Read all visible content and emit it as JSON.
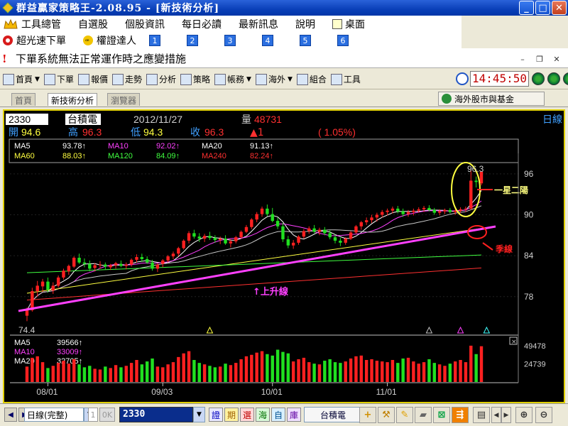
{
  "window": {
    "title": "群益贏家策略王-2.08.95 - [新技術分析]",
    "min": "_",
    "max": "□",
    "close": "✕"
  },
  "menu": {
    "items": [
      "工具總管",
      "自選股",
      "個股資訊",
      "每日必讀",
      "最新訊息",
      "說明"
    ],
    "desk": "桌面"
  },
  "quick": {
    "items": [
      "超光速下單",
      "權證達人"
    ],
    "numbers": [
      "1",
      "2",
      "3",
      "4",
      "5",
      "6"
    ]
  },
  "notice": {
    "text": "下單系統無法正常運作時之應變措施"
  },
  "mdi": {
    "min": "–",
    "restore": "❐",
    "close": "✕"
  },
  "toolbar": {
    "items": [
      "首頁",
      "下單",
      "報價",
      "走勢",
      "分析",
      "策略",
      "帳務",
      "海外",
      "組合",
      "工具"
    ],
    "clock": "14:45:50"
  },
  "tabs": {
    "items": [
      "首頁",
      "新技術分析",
      "瀏覽器"
    ],
    "oversea": "海外股市與基金"
  },
  "chart_data": {
    "type": "candlestick",
    "header": {
      "code": "2330",
      "name": "台積電",
      "date": "2012/11/27",
      "vol_label": "量",
      "vol": "48731",
      "open_label": "開",
      "open": "94.6",
      "high_label": "高",
      "high": "96.3",
      "low_label": "低",
      "low": "94.3",
      "close_label": "收",
      "close": "96.3",
      "change": "▲1",
      "pct": "( 1.05%)",
      "period": "日線"
    },
    "ma": [
      {
        "name": "MA5",
        "value": "93.78↑",
        "color": "#ffffff"
      },
      {
        "name": "MA10",
        "value": "92.02↑",
        "color": "#ff40ff"
      },
      {
        "name": "MA20",
        "value": "91.13↑",
        "color": "#ffffff"
      },
      {
        "name": "MA60",
        "value": "88.03↑",
        "color": "#ffff40"
      },
      {
        "name": "MA120",
        "value": "84.09↑",
        "color": "#40ff40"
      },
      {
        "name": "MA240",
        "value": "82.24↑",
        "color": "#ff3030"
      }
    ],
    "vol_ma": [
      {
        "name": "MA5",
        "value": "39566↑",
        "color": "#ffffff"
      },
      {
        "name": "MA10",
        "value": "33009↑",
        "color": "#ff40ff"
      },
      {
        "name": "MA20",
        "value": "32705↑",
        "color": "#ffffff"
      }
    ],
    "yticks": [
      "96",
      "90",
      "84",
      "78"
    ],
    "ylim": [
      73.5,
      99
    ],
    "vol_ticks": [
      "49478",
      "24739"
    ],
    "vol_max": 60000,
    "xticks": [
      {
        "i": 4,
        "label": "08/01"
      },
      {
        "i": 26,
        "label": "09/03"
      },
      {
        "i": 47,
        "label": "10/01"
      },
      {
        "i": 69,
        "label": "11/01"
      }
    ],
    "annot": {
      "peak": "96.3",
      "low": "74.4",
      "uptrend": "↑上升線",
      "season": "季線",
      "pattern": "一星二陽",
      "close_box": "×"
    },
    "candles": [
      [
        75.2,
        76.4,
        74.4,
        76.0
      ],
      [
        76.0,
        79.3,
        75.8,
        78.8
      ],
      [
        78.8,
        80.3,
        78.0,
        79.6
      ],
      [
        79.5,
        80.6,
        78.7,
        80.2
      ],
      [
        80.2,
        80.8,
        78.6,
        79.0
      ],
      [
        78.9,
        80.1,
        78.4,
        79.6
      ],
      [
        79.6,
        81.1,
        79.3,
        80.8
      ],
      [
        80.8,
        82.1,
        80.5,
        81.8
      ],
      [
        81.7,
        82.7,
        81.2,
        82.5
      ],
      [
        82.4,
        83.9,
        82.2,
        83.7
      ],
      [
        83.7,
        84.3,
        82.8,
        83.0
      ],
      [
        83.0,
        83.6,
        82.3,
        82.8
      ],
      [
        82.8,
        83.3,
        81.7,
        82.1
      ],
      [
        82.2,
        82.9,
        81.7,
        82.6
      ],
      [
        82.6,
        83.2,
        82.1,
        82.7
      ],
      [
        82.7,
        83.0,
        82.0,
        82.4
      ],
      [
        82.3,
        82.8,
        81.9,
        82.6
      ],
      [
        82.6,
        83.1,
        82.1,
        82.9
      ],
      [
        82.8,
        83.3,
        82.3,
        82.5
      ],
      [
        82.5,
        83.0,
        82.0,
        82.7
      ],
      [
        82.7,
        83.6,
        82.4,
        83.4
      ],
      [
        83.4,
        84.2,
        83.0,
        83.8
      ],
      [
        83.8,
        84.3,
        83.1,
        83.5
      ],
      [
        83.5,
        83.9,
        82.8,
        83.0
      ],
      [
        83.0,
        83.4,
        81.8,
        82.1
      ],
      [
        82.1,
        82.9,
        81.6,
        82.7
      ],
      [
        82.8,
        83.5,
        82.3,
        83.3
      ],
      [
        83.3,
        84.1,
        83.0,
        83.9
      ],
      [
        83.9,
        84.6,
        83.5,
        84.3
      ],
      [
        84.3,
        85.3,
        83.9,
        85.1
      ],
      [
        85.1,
        86.4,
        84.9,
        86.2
      ],
      [
        86.2,
        87.6,
        85.8,
        87.3
      ],
      [
        87.3,
        87.8,
        86.5,
        86.8
      ],
      [
        86.8,
        87.3,
        86.0,
        86.5
      ],
      [
        86.5,
        87.2,
        86.0,
        86.9
      ],
      [
        86.9,
        87.5,
        86.3,
        86.6
      ],
      [
        86.6,
        87.0,
        85.9,
        86.3
      ],
      [
        86.3,
        86.8,
        85.7,
        86.5
      ],
      [
        86.5,
        87.0,
        85.6,
        85.8
      ],
      [
        85.8,
        86.4,
        85.2,
        86.1
      ],
      [
        86.1,
        86.9,
        85.8,
        86.7
      ],
      [
        86.7,
        87.7,
        86.5,
        87.5
      ],
      [
        87.5,
        88.5,
        87.3,
        88.2
      ],
      [
        88.2,
        89.5,
        87.9,
        89.3
      ],
      [
        89.3,
        90.4,
        88.9,
        90.1
      ],
      [
        90.1,
        91.2,
        89.7,
        90.9
      ],
      [
        90.9,
        91.5,
        89.8,
        90.1
      ],
      [
        90.1,
        91.0,
        88.9,
        89.1
      ],
      [
        89.1,
        89.6,
        87.9,
        88.3
      ],
      [
        88.3,
        88.8,
        86.0,
        86.4
      ],
      [
        86.4,
        86.9,
        85.1,
        85.5
      ],
      [
        85.5,
        86.3,
        85.0,
        85.9
      ],
      [
        85.9,
        87.0,
        85.6,
        86.8
      ],
      [
        86.8,
        87.9,
        86.5,
        87.6
      ],
      [
        87.6,
        88.3,
        87.2,
        88.0
      ],
      [
        88.0,
        88.5,
        87.3,
        87.5
      ],
      [
        87.5,
        88.1,
        87.0,
        87.8
      ],
      [
        87.8,
        88.2,
        87.0,
        87.3
      ],
      [
        87.3,
        87.7,
        86.4,
        86.7
      ],
      [
        86.7,
        87.1,
        85.8,
        86.2
      ],
      [
        86.2,
        86.6,
        85.4,
        85.9
      ],
      [
        85.9,
        86.7,
        85.6,
        86.5
      ],
      [
        86.5,
        87.6,
        86.3,
        87.4
      ],
      [
        87.4,
        88.5,
        87.2,
        88.3
      ],
      [
        88.3,
        89.1,
        87.8,
        88.9
      ],
      [
        88.9,
        89.6,
        88.5,
        89.2
      ],
      [
        89.2,
        90.0,
        88.8,
        89.6
      ],
      [
        89.6,
        90.3,
        89.0,
        90.0
      ],
      [
        90.0,
        90.7,
        89.6,
        90.4
      ],
      [
        90.4,
        90.9,
        89.9,
        90.6
      ],
      [
        90.6,
        91.2,
        90.2,
        90.9
      ],
      [
        90.9,
        91.3,
        90.2,
        90.5
      ],
      [
        90.5,
        90.9,
        89.7,
        90.1
      ],
      [
        90.1,
        90.7,
        89.7,
        90.4
      ],
      [
        90.4,
        90.9,
        89.9,
        90.6
      ],
      [
        90.6,
        91.1,
        90.3,
        90.8
      ],
      [
        90.8,
        91.3,
        90.4,
        91.0
      ],
      [
        91.0,
        91.4,
        90.5,
        90.7
      ],
      [
        90.7,
        91.0,
        90.0,
        90.3
      ],
      [
        90.3,
        90.8,
        89.9,
        90.5
      ],
      [
        90.5,
        90.9,
        90.1,
        90.7
      ],
      [
        90.7,
        91.0,
        90.2,
        90.4
      ],
      [
        90.4,
        90.8,
        90.0,
        90.6
      ],
      [
        90.6,
        91.1,
        90.3,
        90.8
      ],
      [
        90.8,
        91.2,
        90.4,
        90.9
      ],
      [
        90.9,
        96.5,
        90.7,
        95.0
      ],
      [
        95.0,
        95.6,
        94.0,
        94.8
      ],
      [
        94.6,
        96.3,
        94.3,
        96.3
      ]
    ],
    "volume": [
      21000,
      33000,
      35000,
      27000,
      19000,
      22000,
      26000,
      29000,
      25000,
      31000,
      24000,
      20000,
      22000,
      18000,
      17000,
      21000,
      19000,
      23000,
      20000,
      22000,
      26000,
      30000,
      24000,
      28000,
      32000,
      21000,
      20000,
      24000,
      27000,
      34000,
      39000,
      42000,
      30000,
      26000,
      24000,
      22000,
      20000,
      21000,
      25000,
      23000,
      26000,
      31000,
      35000,
      37000,
      40000,
      42000,
      38000,
      36000,
      44000,
      41000,
      39000,
      28000,
      31000,
      33000,
      27000,
      25000,
      24000,
      29000,
      31000,
      27000,
      26000,
      28000,
      32000,
      35000,
      36000,
      30000,
      31000,
      29000,
      28000,
      27000,
      30000,
      26000,
      32000,
      33000,
      28000,
      25000,
      27000,
      31000,
      26000,
      24000,
      22000,
      25000,
      28000,
      30000,
      27000,
      49478,
      38000,
      48731
    ]
  },
  "bottom": {
    "period_select": "日線(完整)",
    "spin": "1",
    "ok": "0K",
    "code": "2330",
    "quick_tags": [
      "證",
      "期",
      "選",
      "海",
      "自",
      "庫"
    ],
    "stock_name": "台積電"
  }
}
